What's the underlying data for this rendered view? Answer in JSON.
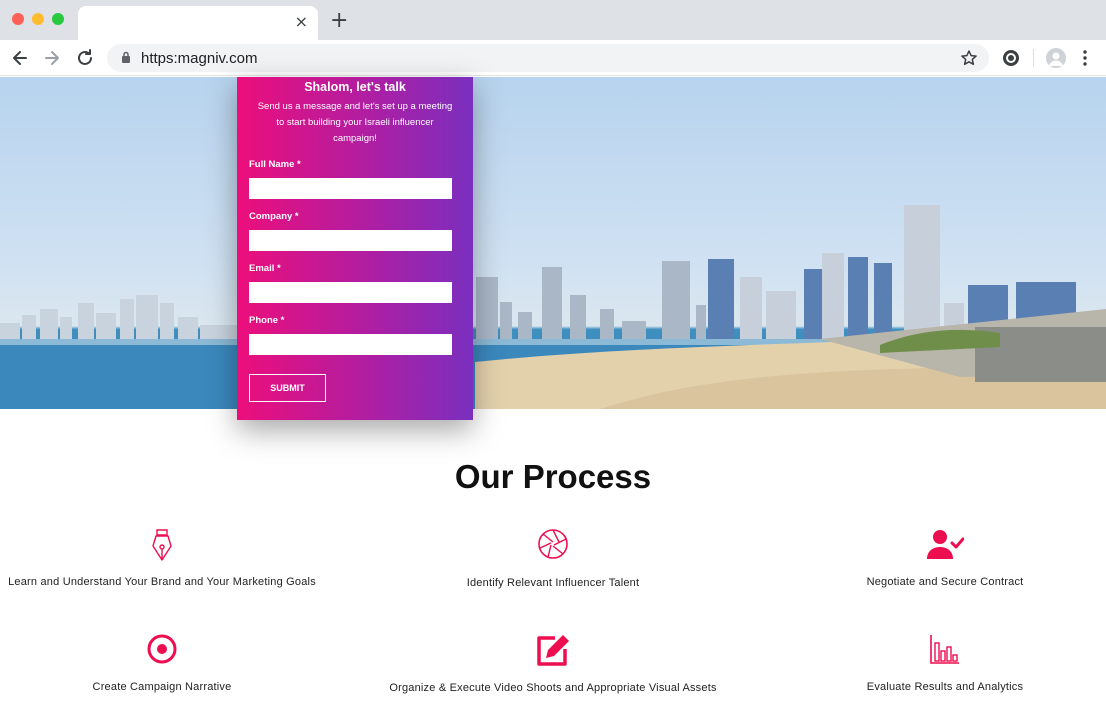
{
  "browser": {
    "url": "https:magniv.com",
    "tab_close": "×",
    "new_tab": "+"
  },
  "form": {
    "title": "Shalom, let's talk",
    "subtitle": "Send us a message and let's set up a meeting to start building your Israeli influencer campaign!",
    "fields": [
      {
        "label": "Full Name  *",
        "value": ""
      },
      {
        "label": "Company  *",
        "value": ""
      },
      {
        "label": "Email  *",
        "value": ""
      },
      {
        "label": "Phone  *",
        "value": ""
      }
    ],
    "submit_label": "SUBMIT"
  },
  "process": {
    "title": "Our Process",
    "steps": [
      {
        "label": "Learn and Understand Your Brand and Your Marketing Goals",
        "icon": "pen-nib-icon"
      },
      {
        "label": "Identify Relevant Influencer Talent",
        "icon": "aperture-icon"
      },
      {
        "label": "Negotiate and Secure Contract",
        "icon": "user-check-icon"
      },
      {
        "label": "Create Campaign Narrative",
        "icon": "target-dot-icon"
      },
      {
        "label": "Organize & Execute Video Shoots and Appropriate Visual Assets",
        "icon": "edit-icon"
      },
      {
        "label": "Evaluate Results and Analytics",
        "icon": "bar-chart-icon"
      }
    ]
  },
  "colors": {
    "accent": "#ec0e4f",
    "card_start": "#ec0e7b",
    "card_end": "#7a2fbf"
  }
}
